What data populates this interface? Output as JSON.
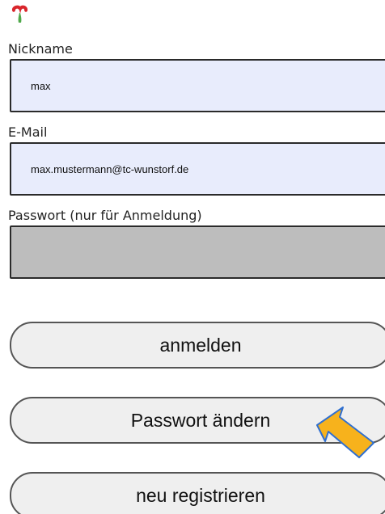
{
  "logo": {
    "icon": "club-logo-icon",
    "colors": [
      "#d9262c",
      "#4fa84a"
    ]
  },
  "form": {
    "nickname": {
      "label": "Nickname",
      "value": "max"
    },
    "email": {
      "label": "E-Mail",
      "value": "max.mustermann@tc-wunstorf.de"
    },
    "password": {
      "label": "Passwort (nur für Anmeldung)",
      "value": ""
    }
  },
  "buttons": {
    "login_label": "anmelden",
    "change_password_label": "Passwort ändern",
    "register_label": "neu registrieren"
  },
  "annotation": {
    "icon": "pointer-arrow-icon",
    "color": "#f7b21c"
  }
}
